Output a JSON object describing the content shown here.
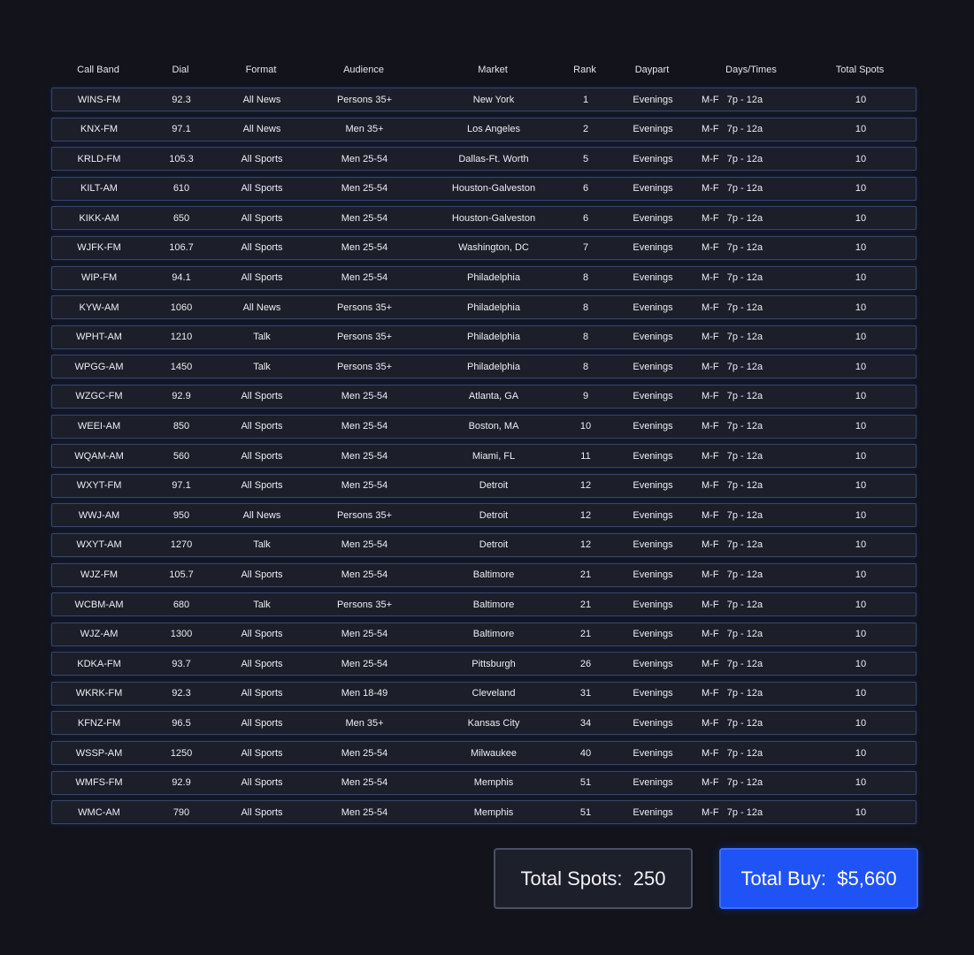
{
  "table": {
    "headers": {
      "call_band": "Call Band",
      "dial": "Dial",
      "format": "Format",
      "audience": "Audience",
      "market": "Market",
      "rank": "Rank",
      "daypart": "Daypart",
      "days_times": "Days/Times",
      "total_spots": "Total Spots"
    },
    "rows": [
      {
        "call_band": "WINS-FM",
        "dial": "92.3",
        "format": "All News",
        "audience": "Persons 35+",
        "market": "New York",
        "rank": "1",
        "daypart": "Evenings",
        "days_times": "M-F   7p - 12a",
        "total_spots": "10"
      },
      {
        "call_band": "KNX-FM",
        "dial": "97.1",
        "format": "All News",
        "audience": "Men 35+",
        "market": "Los Angeles",
        "rank": "2",
        "daypart": "Evenings",
        "days_times": "M-F   7p - 12a",
        "total_spots": "10"
      },
      {
        "call_band": "KRLD-FM",
        "dial": "105.3",
        "format": "All Sports",
        "audience": "Men 25-54",
        "market": "Dallas-Ft. Worth",
        "rank": "5",
        "daypart": "Evenings",
        "days_times": "M-F   7p - 12a",
        "total_spots": "10"
      },
      {
        "call_band": "KILT-AM",
        "dial": "610",
        "format": "All Sports",
        "audience": "Men 25-54",
        "market": "Houston-Galveston",
        "rank": "6",
        "daypart": "Evenings",
        "days_times": "M-F   7p - 12a",
        "total_spots": "10"
      },
      {
        "call_band": "KIKK-AM",
        "dial": "650",
        "format": "All Sports",
        "audience": "Men 25-54",
        "market": "Houston-Galveston",
        "rank": "6",
        "daypart": "Evenings",
        "days_times": "M-F   7p - 12a",
        "total_spots": "10"
      },
      {
        "call_band": "WJFK-FM",
        "dial": "106.7",
        "format": "All Sports",
        "audience": "Men 25-54",
        "market": "Washington, DC",
        "rank": "7",
        "daypart": "Evenings",
        "days_times": "M-F   7p - 12a",
        "total_spots": "10"
      },
      {
        "call_band": "WIP-FM",
        "dial": "94.1",
        "format": "All Sports",
        "audience": "Men 25-54",
        "market": "Philadelphia",
        "rank": "8",
        "daypart": "Evenings",
        "days_times": "M-F   7p - 12a",
        "total_spots": "10"
      },
      {
        "call_band": "KYW-AM",
        "dial": "1060",
        "format": "All News",
        "audience": "Persons 35+",
        "market": "Philadelphia",
        "rank": "8",
        "daypart": "Evenings",
        "days_times": "M-F   7p - 12a",
        "total_spots": "10"
      },
      {
        "call_band": "WPHT-AM",
        "dial": "1210",
        "format": "Talk",
        "audience": "Persons 35+",
        "market": "Philadelphia",
        "rank": "8",
        "daypart": "Evenings",
        "days_times": "M-F   7p - 12a",
        "total_spots": "10"
      },
      {
        "call_band": "WPGG-AM",
        "dial": "1450",
        "format": "Talk",
        "audience": "Persons 35+",
        "market": "Philadelphia",
        "rank": "8",
        "daypart": "Evenings",
        "days_times": "M-F   7p - 12a",
        "total_spots": "10"
      },
      {
        "call_band": "WZGC-FM",
        "dial": "92.9",
        "format": "All Sports",
        "audience": "Men 25-54",
        "market": "Atlanta, GA",
        "rank": "9",
        "daypart": "Evenings",
        "days_times": "M-F   7p - 12a",
        "total_spots": "10"
      },
      {
        "call_band": "WEEI-AM",
        "dial": "850",
        "format": "All Sports",
        "audience": "Men 25-54",
        "market": "Boston, MA",
        "rank": "10",
        "daypart": "Evenings",
        "days_times": "M-F   7p - 12a",
        "total_spots": "10"
      },
      {
        "call_band": "WQAM-AM",
        "dial": "560",
        "format": "All Sports",
        "audience": "Men 25-54",
        "market": "Miami, FL",
        "rank": "11",
        "daypart": "Evenings",
        "days_times": "M-F   7p - 12a",
        "total_spots": "10"
      },
      {
        "call_band": "WXYT-FM",
        "dial": "97.1",
        "format": "All Sports",
        "audience": "Men 25-54",
        "market": "Detroit",
        "rank": "12",
        "daypart": "Evenings",
        "days_times": "M-F   7p - 12a",
        "total_spots": "10"
      },
      {
        "call_band": "WWJ-AM",
        "dial": "950",
        "format": "All News",
        "audience": "Persons 35+",
        "market": "Detroit",
        "rank": "12",
        "daypart": "Evenings",
        "days_times": "M-F   7p - 12a",
        "total_spots": "10"
      },
      {
        "call_band": "WXYT-AM",
        "dial": "1270",
        "format": "Talk",
        "audience": "Men 25-54",
        "market": "Detroit",
        "rank": "12",
        "daypart": "Evenings",
        "days_times": "M-F   7p - 12a",
        "total_spots": "10"
      },
      {
        "call_band": "WJZ-FM",
        "dial": "105.7",
        "format": "All Sports",
        "audience": "Men 25-54",
        "market": "Baltimore",
        "rank": "21",
        "daypart": "Evenings",
        "days_times": "M-F   7p - 12a",
        "total_spots": "10"
      },
      {
        "call_band": "WCBM-AM",
        "dial": "680",
        "format": "Talk",
        "audience": "Persons 35+",
        "market": "Baltimore",
        "rank": "21",
        "daypart": "Evenings",
        "days_times": "M-F   7p - 12a",
        "total_spots": "10"
      },
      {
        "call_band": "WJZ-AM",
        "dial": "1300",
        "format": "All Sports",
        "audience": "Men 25-54",
        "market": "Baltimore",
        "rank": "21",
        "daypart": "Evenings",
        "days_times": "M-F   7p - 12a",
        "total_spots": "10"
      },
      {
        "call_band": "KDKA-FM",
        "dial": "93.7",
        "format": "All Sports",
        "audience": "Men 25-54",
        "market": "Pittsburgh",
        "rank": "26",
        "daypart": "Evenings",
        "days_times": "M-F   7p - 12a",
        "total_spots": "10"
      },
      {
        "call_band": "WKRK-FM",
        "dial": "92.3",
        "format": "All Sports",
        "audience": "Men 18-49",
        "market": "Cleveland",
        "rank": "31",
        "daypart": "Evenings",
        "days_times": "M-F   7p - 12a",
        "total_spots": "10"
      },
      {
        "call_band": "KFNZ-FM",
        "dial": "96.5",
        "format": "All Sports",
        "audience": "Men 35+",
        "market": "Kansas City",
        "rank": "34",
        "daypart": "Evenings",
        "days_times": "M-F   7p - 12a",
        "total_spots": "10"
      },
      {
        "call_band": "WSSP-AM",
        "dial": "1250",
        "format": "All Sports",
        "audience": "Men 25-54",
        "market": "Milwaukee",
        "rank": "40",
        "daypart": "Evenings",
        "days_times": "M-F   7p - 12a",
        "total_spots": "10"
      },
      {
        "call_band": "WMFS-FM",
        "dial": "92.9",
        "format": "All Sports",
        "audience": "Men 25-54",
        "market": "Memphis",
        "rank": "51",
        "daypart": "Evenings",
        "days_times": "M-F   7p - 12a",
        "total_spots": "10"
      },
      {
        "call_band": "WMC-AM",
        "dial": "790",
        "format": "All Sports",
        "audience": "Men 25-54",
        "market": "Memphis",
        "rank": "51",
        "daypart": "Evenings",
        "days_times": "M-F   7p - 12a",
        "total_spots": "10"
      }
    ]
  },
  "totals": {
    "spots_text": "Total Spots:  250",
    "buy_text": "Total Buy:  $5,660"
  },
  "colors": {
    "background": "#12131b",
    "row_background": "#1c1e29",
    "row_border": "#394668",
    "accent_blue": "#1f53f5"
  }
}
